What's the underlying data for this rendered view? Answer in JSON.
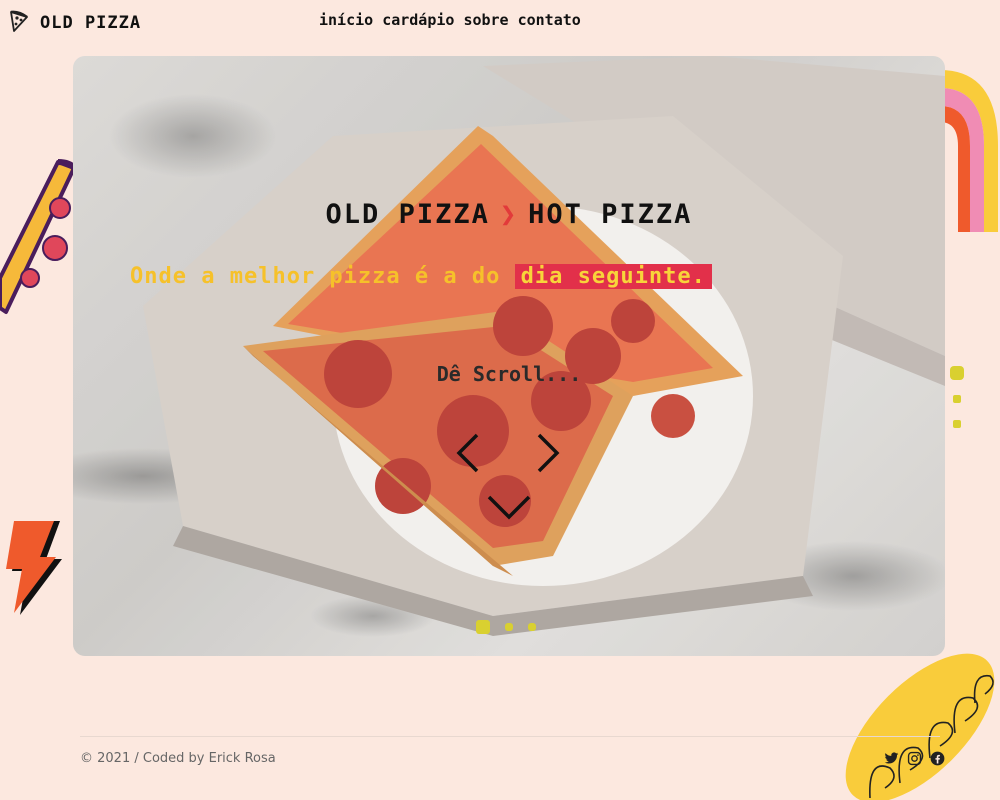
{
  "brand": {
    "name": "OLD PIZZA",
    "logo_icon": "pizza-slice-icon"
  },
  "nav": {
    "items": [
      {
        "label": "início"
      },
      {
        "label": "cardápio"
      },
      {
        "label": "sobre"
      },
      {
        "label": "contato"
      }
    ]
  },
  "hero": {
    "title_left": "OLD PIZZA",
    "title_separator": "❯",
    "title_right": "HOT PIZZA",
    "tagline_main": "Onde a melhor pizza é a do",
    "tagline_highlight": "dia seguinte.",
    "scroll_label": "Dê Scroll..."
  },
  "footer": {
    "copyright": "© 2021 / Coded by Erick Rosa",
    "social_icons": [
      "twitter-icon",
      "instagram-icon",
      "facebook-icon"
    ]
  },
  "colors": {
    "page_bg": "#fce8df",
    "tagline_yellow": "#f6c12a",
    "highlight_red": "#e2304a",
    "accent_orange": "#f15a2b",
    "accent_pink": "#f08cb4",
    "accent_yellow": "#f9cc3b"
  }
}
